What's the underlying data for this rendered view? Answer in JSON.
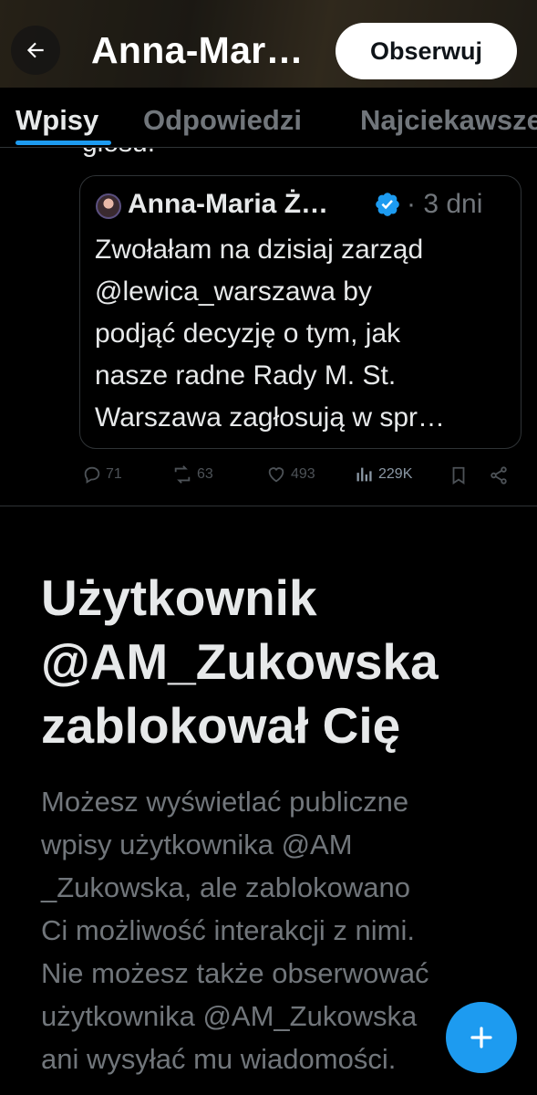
{
  "header": {
    "title": "Anna-Mar…",
    "follow_label": "Obserwuj"
  },
  "tabs": [
    {
      "label": "Wpisy",
      "active": true
    },
    {
      "label": "Odpowiedzi",
      "active": false
    },
    {
      "label": "Najciekawsze",
      "active": false
    }
  ],
  "post": {
    "cut_text": "głosu.",
    "quote": {
      "author": "Anna-Maria Ż…",
      "separator": "·",
      "time": "3 dni",
      "verified": true,
      "body_lines": [
        "Zwołałam na dzisiaj zarząd",
        "@lewica_warszawa by",
        "podjąć decyzję o tym, jak",
        "nasze radne Rady M. St.",
        "Warszawa zagłosują w spr…"
      ]
    },
    "stats": {
      "replies": "71",
      "reposts": "63",
      "likes": "493",
      "views": "229K"
    }
  },
  "blocked": {
    "title_lines": [
      "Użytkownik",
      "@AM_Zukowska",
      "zablokował Cię"
    ],
    "desc_lines": [
      "Możesz wyświetlać publiczne",
      "wpisy użytkownika @AM",
      "_Zukowska, ale zablokowano",
      "Ci możliwość interakcji z nimi.",
      "Nie możesz także obserwować",
      "użytkownika @AM_Zukowska",
      "ani wysyłać mu wiadomości."
    ]
  },
  "colors": {
    "accent": "#1d9bf0",
    "background": "#000000",
    "text": "#e7e9ea",
    "muted": "#71767b"
  },
  "icons": [
    "back-arrow-icon",
    "verified-badge-icon",
    "reply-icon",
    "repost-icon",
    "like-icon",
    "views-icon",
    "bookmark-icon",
    "share-icon",
    "plus-icon"
  ]
}
